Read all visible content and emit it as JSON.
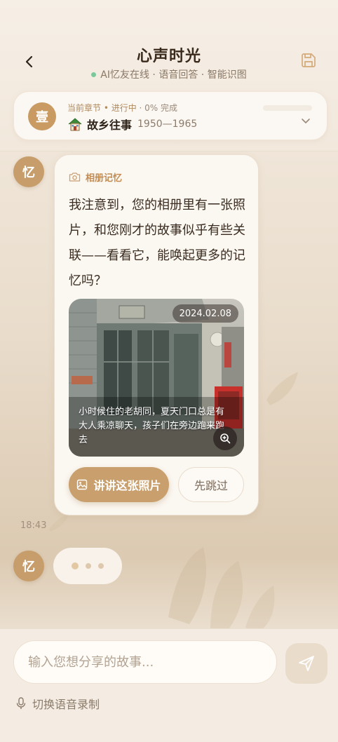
{
  "header": {
    "title": "心声时光",
    "subtitle": "AI忆友在线 · 语音回答 · 智能识图",
    "back_icon": "chevron-left-icon",
    "save_icon": "save-icon"
  },
  "chapter": {
    "badge": "壹",
    "meta": "当前章节 • 进行中",
    "progress_label": "· 0% 完成",
    "progress_value": 0,
    "name": "故乡往事",
    "years": "1950—1965"
  },
  "message": {
    "avatar": "忆",
    "tag": "相册记忆",
    "text": "我注意到，您的相册里有一张照片，和您刚才的故事似乎有些关联——看看它，能唤起更多的记忆吗？",
    "photo": {
      "date": "2024.02.08",
      "caption": "小时候住的老胡同，夏天门口总是有大人乘凉聊天，孩子们在旁边跑来跑去"
    },
    "primary_button": "讲讲这张照片",
    "secondary_button": "先跳过",
    "time": "18:43"
  },
  "typing": {
    "avatar": "忆"
  },
  "composer": {
    "placeholder": "输入您想分享的故事...",
    "voice_toggle": "切换语音录制"
  },
  "colors": {
    "accent": "#c9a06d",
    "online": "#7bc99a",
    "background": "#e9dccb"
  }
}
